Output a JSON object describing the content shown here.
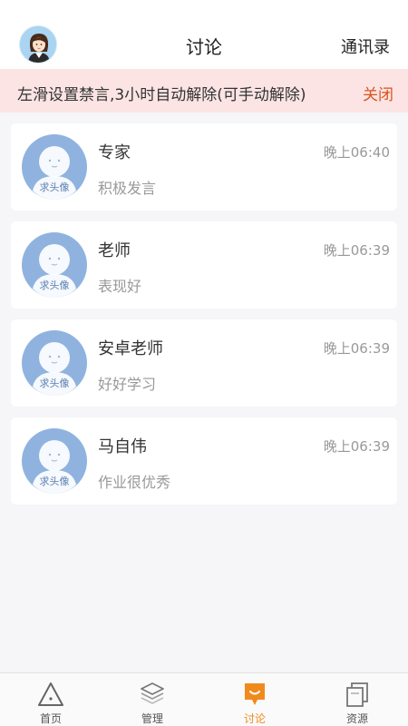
{
  "header": {
    "title": "讨论",
    "contacts_label": "通讯录"
  },
  "notice": {
    "message": "左滑设置禁言,3小时自动解除(可手动解除)",
    "close_label": "关闭"
  },
  "avatar_placeholder_text": "求头像",
  "conversations": [
    {
      "name": "专家",
      "time": "晚上06:40",
      "preview": "积极发言"
    },
    {
      "name": "老师",
      "time": "晚上06:39",
      "preview": "表现好"
    },
    {
      "name": "安卓老师",
      "time": "晚上06:39",
      "preview": "好好学习"
    },
    {
      "name": "马自伟",
      "time": "晚上06:39",
      "preview": "作业很优秀"
    }
  ],
  "tabs": [
    {
      "label": "首页",
      "icon": "triangle-icon",
      "active": false
    },
    {
      "label": "管理",
      "icon": "layers-icon",
      "active": false
    },
    {
      "label": "讨论",
      "icon": "chat-icon",
      "active": true
    },
    {
      "label": "资源",
      "icon": "documents-icon",
      "active": false
    }
  ],
  "colors": {
    "accent": "#f08a1c",
    "notice_bg": "#fce4e4",
    "close_text": "#d9531e",
    "avatar_blue": "#8fb3de"
  }
}
